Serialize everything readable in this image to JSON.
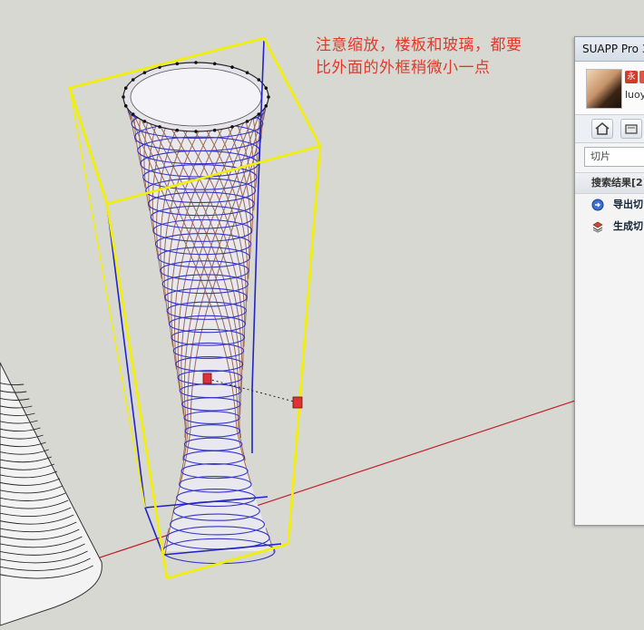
{
  "annotation": {
    "line1": "注意缩放，楼板和玻璃，都要",
    "line2": "比外面的外框稍微小一点"
  },
  "panel": {
    "title": "SUAPP Pro 3",
    "username": "luoy",
    "badge": "永",
    "search_value": "切片",
    "section_label": "搜索结果[2",
    "results": [
      {
        "label": "导出切",
        "icon": "export-slice-icon"
      },
      {
        "label": "生成切",
        "icon": "generate-slice-icon"
      }
    ]
  },
  "colors": {
    "background": "#d8d8d2",
    "annotation_text": "#e0392a",
    "bounding_box_yellow": "#f2f000",
    "bounding_box_blue": "#2323c8",
    "axis_red": "#c0202a"
  }
}
